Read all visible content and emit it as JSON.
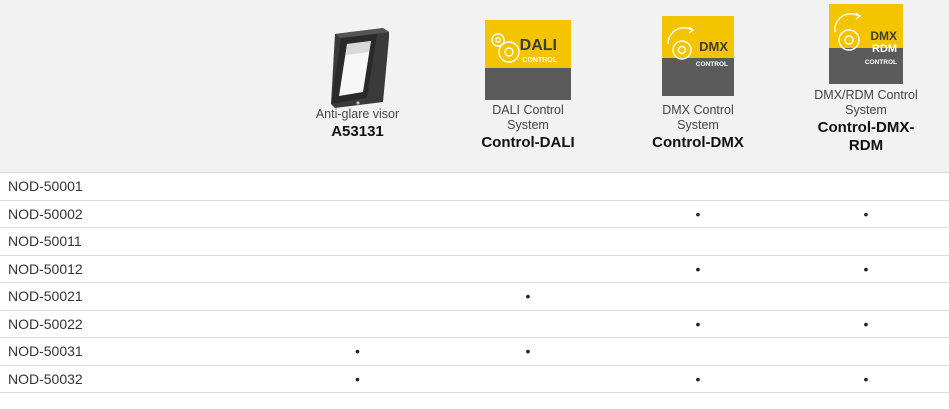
{
  "header": {
    "columns": [
      {
        "id": "visor",
        "subtitle": "Anti-glare visor",
        "code": "A53131"
      },
      {
        "id": "dali",
        "badge_top": "DALI",
        "badge_bottom": "CONTROL",
        "subtitle": "DALI Control System",
        "code": "Control-DALI"
      },
      {
        "id": "dmx",
        "badge_top": "DMX",
        "badge_bottom": "CONTROL",
        "subtitle": "DMX Control System",
        "code": "Control-DMX"
      },
      {
        "id": "dmxrdm",
        "badge_top": "DMX",
        "badge_mid": "RDM",
        "badge_bottom": "CONTROL",
        "subtitle": "DMX/RDM Control System",
        "code": "Control-DMX-RDM"
      }
    ]
  },
  "rows": [
    {
      "name": "NOD-50001",
      "marks": [
        "",
        "",
        "",
        ""
      ]
    },
    {
      "name": "NOD-50002",
      "marks": [
        "",
        "",
        "•",
        "•"
      ]
    },
    {
      "name": "NOD-50011",
      "marks": [
        "",
        "",
        "",
        ""
      ]
    },
    {
      "name": "NOD-50012",
      "marks": [
        "",
        "",
        "•",
        "•"
      ]
    },
    {
      "name": "NOD-50021",
      "marks": [
        "",
        "•",
        "",
        ""
      ]
    },
    {
      "name": "NOD-50022",
      "marks": [
        "",
        "",
        "•",
        "•"
      ]
    },
    {
      "name": "NOD-50031",
      "marks": [
        "•",
        "•",
        "",
        ""
      ]
    },
    {
      "name": "NOD-50032",
      "marks": [
        "•",
        "",
        "•",
        "•"
      ]
    }
  ],
  "colors": {
    "badge_yellow": "#f5c400",
    "badge_dark": "#5b5b5b",
    "header_bg": "#f2f2f2"
  }
}
